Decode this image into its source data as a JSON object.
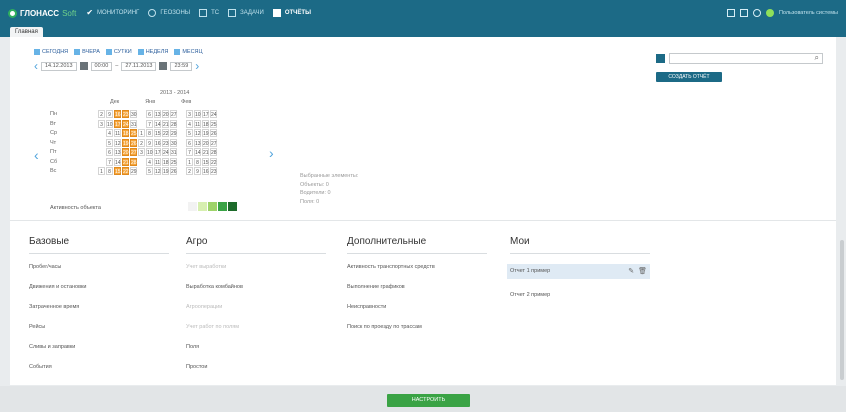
{
  "app": {
    "logo_main": "ГЛОНАСС",
    "logo_soft": "Soft"
  },
  "nav": [
    {
      "label": "МОНИТОРИНГ",
      "icon": "check-icon"
    },
    {
      "label": "ГЕОЗОНЫ",
      "icon": "circle-icon"
    },
    {
      "label": "ТС",
      "icon": "box-icon"
    },
    {
      "label": "ЗАДАЧИ",
      "icon": "box-icon"
    },
    {
      "label": "ОТЧЁТЫ",
      "icon": "report-icon",
      "active": true
    }
  ],
  "header_right": {
    "username": "Пользователь системы"
  },
  "tab": {
    "label": "Главная"
  },
  "period_buttons": [
    "СЕГОДНЯ",
    "ВЧЕРА",
    "СУТКИ",
    "НЕДЕЛЯ",
    "МЕСЯЦ"
  ],
  "date_range": {
    "from_date": "14.12.2013",
    "from_time": "00:00",
    "to_date": "27.11.2013",
    "to_time": "23:59"
  },
  "calendar": {
    "year_label": "2013 - 2014",
    "months": [
      "Дек",
      "Янв",
      "Фев"
    ],
    "weekdays": [
      "Пн",
      "Вт",
      "Ср",
      "Чт",
      "Пт",
      "Сб",
      "Вс"
    ]
  },
  "activity_label": "Активность объекта",
  "legend_colors": [
    "#f2f2f2",
    "#d7efb0",
    "#9ed36a",
    "#3aa345",
    "#1d6b2b"
  ],
  "summary": {
    "title": "Выбранные элементы:",
    "objects": "Объекты: 0",
    "drivers": "Водители: 0",
    "zones": "Поля: 0"
  },
  "search": {
    "placeholder": ""
  },
  "create_button": "СОЗДАТЬ ОТЧЁТ",
  "categories": [
    {
      "title": "Базовые",
      "items": [
        {
          "label": "Пробег/часы"
        },
        {
          "label": "Движения и остановки"
        },
        {
          "label": "Затраченное время"
        },
        {
          "label": "Рейсы"
        },
        {
          "label": "Сливы и заправки"
        },
        {
          "label": "События"
        }
      ]
    },
    {
      "title": "Агро",
      "items": [
        {
          "label": "Учет выработки",
          "dim": true
        },
        {
          "label": "Выработка комбайнов"
        },
        {
          "label": "Агрооперации",
          "dim": true
        },
        {
          "label": "Учет работ по полям",
          "dim": true
        },
        {
          "label": "Поля"
        },
        {
          "label": "Простои"
        }
      ]
    },
    {
      "title": "Дополнительные",
      "items": [
        {
          "label": "Активность транспортных средств"
        },
        {
          "label": "Выполнение графиков"
        },
        {
          "label": "Неисправности"
        },
        {
          "label": "Поиск по проезду по трассам"
        }
      ]
    },
    {
      "title": "Мои",
      "items": [
        {
          "label": "Отчет 1 пример",
          "highlight": true
        },
        {
          "label": "Отчет 2 пример"
        }
      ]
    }
  ],
  "configure_button": "НАСТРОИТЬ"
}
